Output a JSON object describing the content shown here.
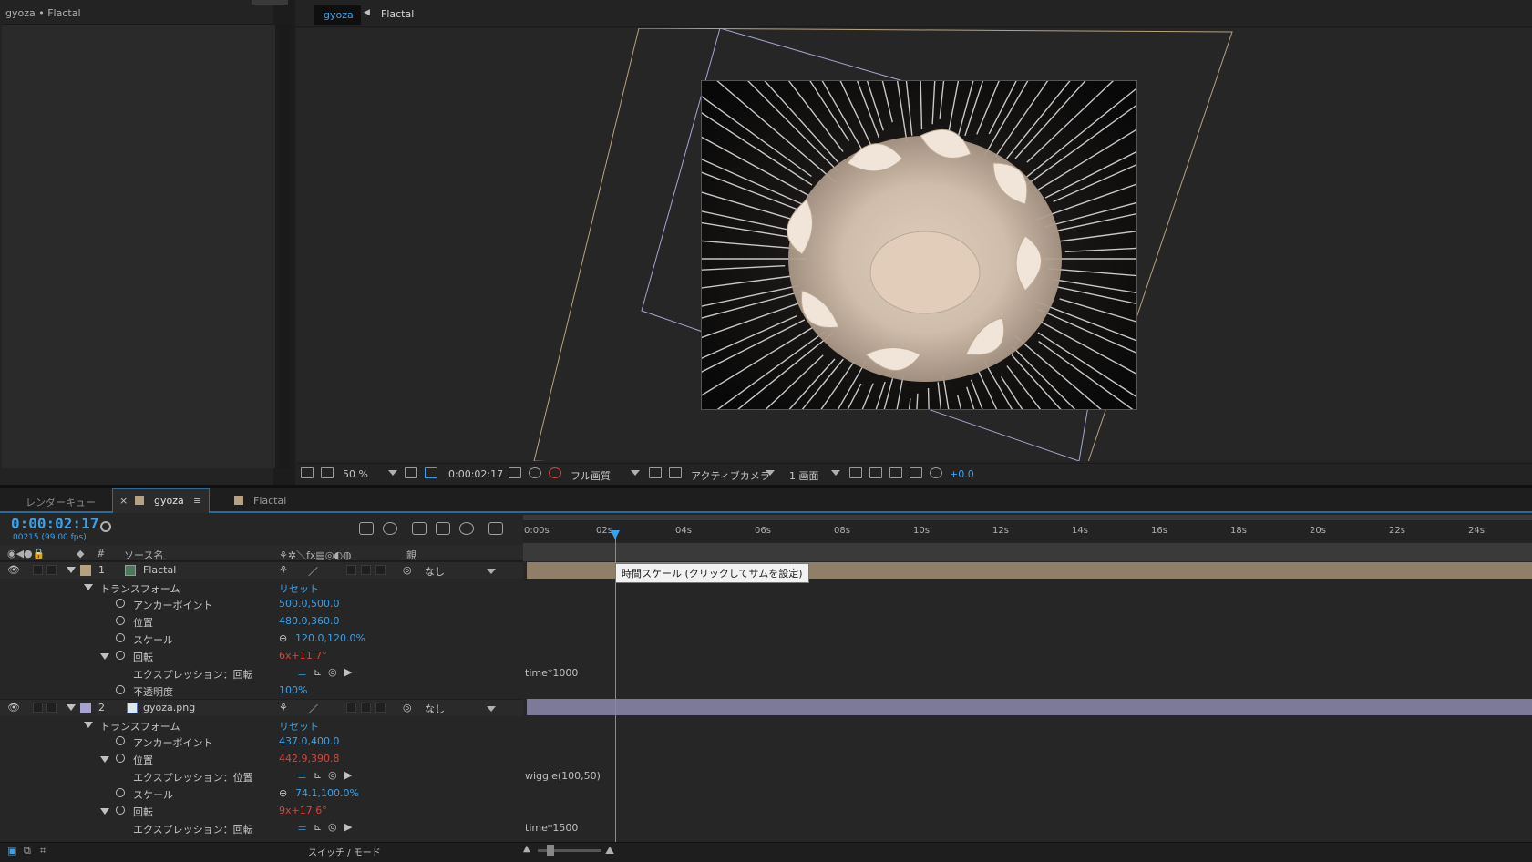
{
  "project": {
    "title": "gyoza • Flactal"
  },
  "viewer": {
    "tabs": [
      "gyoza",
      "Flactal"
    ],
    "toolbar": {
      "zoom": "50 %",
      "timecode": "0:00:02:17",
      "quality": "フル画質",
      "camera": "アクティブカメラ",
      "views": "1 画面",
      "exposure": "+0.0"
    }
  },
  "timeline": {
    "tabs": {
      "render_queue": "レンダーキュー",
      "active": "gyoza",
      "other": "Flactal"
    },
    "timecode": "0:00:02:17",
    "frames": "00215 (99.00 fps)",
    "columns": {
      "num": "#",
      "source": "ソース名",
      "parent": "親"
    },
    "ruler": [
      "0:00s",
      "02s",
      "04s",
      "06s",
      "08s",
      "10s",
      "12s",
      "14s",
      "16s",
      "18s",
      "20s",
      "22s",
      "24s"
    ],
    "tooltip": "時間スケール (クリックしてサムを設定)",
    "layers": [
      {
        "num": "1",
        "name": "Flactal",
        "parent": "なし",
        "label_color": "#b8a17e",
        "transform": "トランスフォーム",
        "reset": "リセット",
        "props": [
          {
            "name": "アンカーポイント",
            "value": "500.0,500.0"
          },
          {
            "name": "位置",
            "value": "480.0,360.0"
          },
          {
            "name": "スケール",
            "value": "120.0,120.0%"
          },
          {
            "name": "回転",
            "value": "6x+11.7°"
          },
          {
            "name": "エクスプレッション：回転",
            "expr": "time*1000"
          },
          {
            "name": "不透明度",
            "value": "100%"
          }
        ]
      },
      {
        "num": "2",
        "name": "gyoza.png",
        "parent": "なし",
        "label_color": "#a7a3cf",
        "transform": "トランスフォーム",
        "reset": "リセット",
        "props": [
          {
            "name": "アンカーポイント",
            "value": "437.0,400.0"
          },
          {
            "name": "位置",
            "value": "442.9,390.8"
          },
          {
            "name": "エクスプレッション：位置",
            "expr": "wiggle(100,50)"
          },
          {
            "name": "スケール",
            "value": "74.1,100.0%"
          },
          {
            "name": "回転",
            "value": "9x+17.6°"
          },
          {
            "name": "エクスプレッション：回転",
            "expr": "time*1500"
          }
        ]
      }
    ],
    "bottom": "スイッチ / モード"
  },
  "colors": {
    "accent": "#38a3ea",
    "keyframe_red": "#d9443a",
    "fractal_bar": "#8f7f68",
    "gyoza_bar": "#7d7a99"
  }
}
